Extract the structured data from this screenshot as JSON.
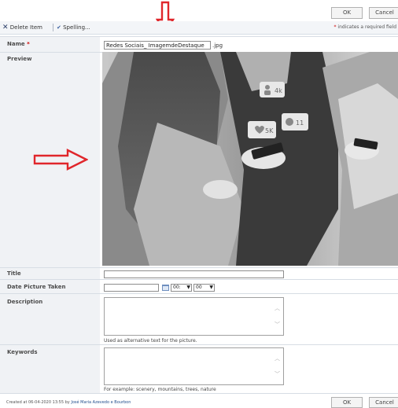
{
  "top_buttons": {
    "ok": "OK",
    "cancel": "Cancel"
  },
  "toolbar": {
    "delete_label": "Delete Item",
    "spelling_label": "Spelling...",
    "required_note": "indicates a required field",
    "required_star": "*"
  },
  "fields": {
    "name": {
      "label": "Name",
      "required_star": "*",
      "value": "Redes Sociais_ ImagemdeDestaque",
      "extension": ".jpg"
    },
    "preview": {
      "label": "Preview",
      "notifications": [
        "4k",
        "5K",
        "11"
      ]
    },
    "title": {
      "label": "Title",
      "value": ""
    },
    "date_taken": {
      "label": "Date Picture Taken",
      "date_value": "",
      "hour": "00:",
      "minute": "00"
    },
    "description": {
      "label": "Description",
      "value": "",
      "hint": "Used as alternative text for the picture."
    },
    "keywords": {
      "label": "Keywords",
      "value": "",
      "hint": "For example: scenery, mountains, trees, nature"
    }
  },
  "footer": {
    "created_prefix": "Created at 06-04-2020 13:55  by",
    "created_by": "José Maria Azevedo e Bourbon",
    "ok": "OK",
    "cancel": "Cancel"
  },
  "colors": {
    "annotation_arrow": "#e0262b",
    "required": "#cc0000",
    "label_bg": "#f0f2f5"
  }
}
